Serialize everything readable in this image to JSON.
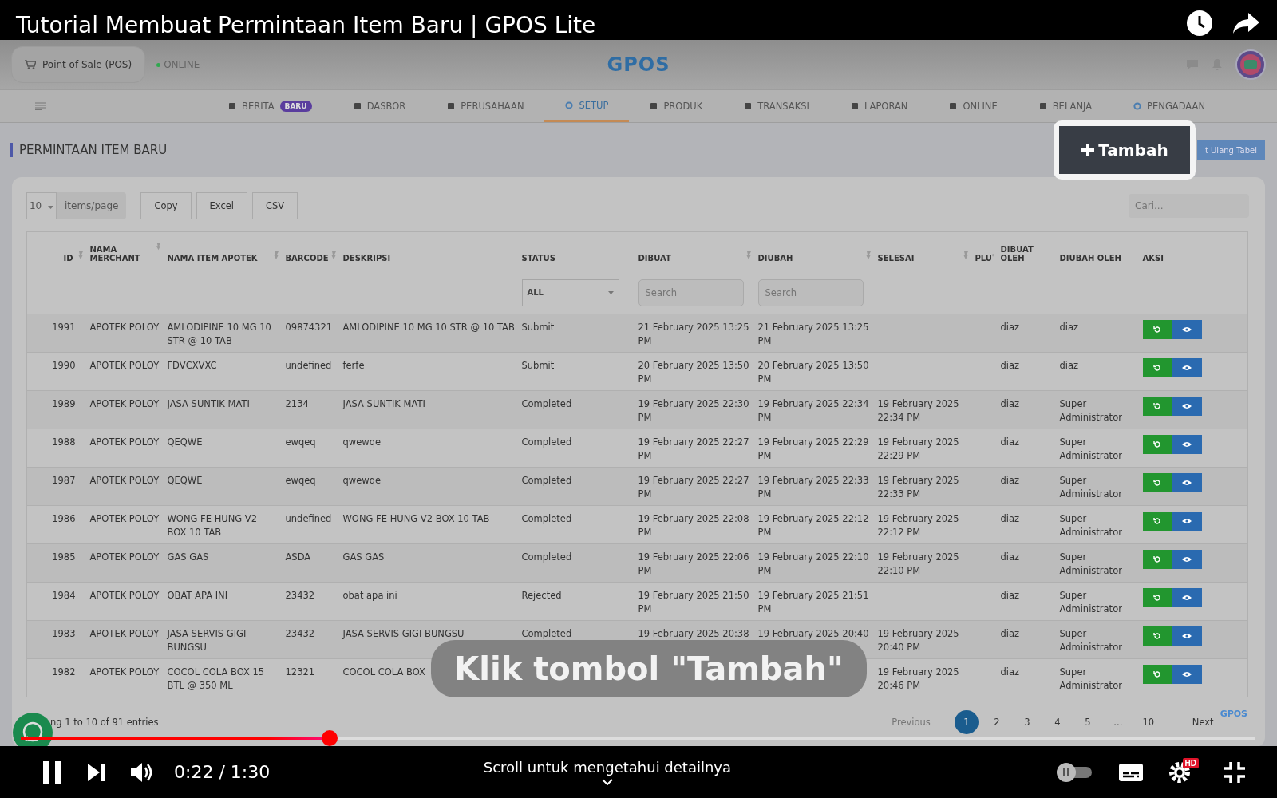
{
  "video_title": "Tutorial Membuat Permintaan Item Baru | GPOS Lite",
  "app": {
    "pos_button": "Point of Sale (POS)",
    "status": "ONLINE",
    "logo": "GPOS",
    "tabs": [
      {
        "label": "BERITA",
        "badge": "BARU",
        "selected": false
      },
      {
        "label": "DASBOR",
        "selected": false
      },
      {
        "label": "PERUSAHAAN",
        "selected": false
      },
      {
        "label": "SETUP",
        "selected": true
      },
      {
        "label": "PRODUK",
        "selected": false
      },
      {
        "label": "TRANSAKSI",
        "selected": false
      },
      {
        "label": "LAPORAN",
        "selected": false
      },
      {
        "label": "ONLINE",
        "selected": false
      },
      {
        "label": "BELANJA",
        "selected": false
      },
      {
        "label": "PENGADAAN",
        "selected": false
      }
    ],
    "page_title": "PERMINTAAN ITEM BARU",
    "add_button": "Tambah",
    "reload_button": "t Ulang Tabel",
    "page_size": "10",
    "page_size_label": "items/page",
    "export_buttons": [
      "Copy",
      "Excel",
      "CSV"
    ],
    "search": {
      "placeholder": "Cari..."
    },
    "table": {
      "columns": [
        {
          "label": "ID",
          "sortable": true
        },
        {
          "label": "NAMA MERCHANT",
          "sortable": true
        },
        {
          "label": "NAMA ITEM APOTEK",
          "sortable": true
        },
        {
          "label": "BARCODE",
          "sortable": true
        },
        {
          "label": "DESKRIPSI",
          "sortable": false
        },
        {
          "label": "STATUS",
          "sortable": false
        },
        {
          "label": "DIBUAT",
          "sortable": true
        },
        {
          "label": "DIUBAH",
          "sortable": true
        },
        {
          "label": "SELESAI",
          "sortable": true
        },
        {
          "label": "PLU",
          "sortable": true
        },
        {
          "label": "DIBUAT OLEH",
          "sortable": false
        },
        {
          "label": "DIUBAH OLEH",
          "sortable": false
        },
        {
          "label": "AKSI",
          "sortable": false
        }
      ],
      "filters": {
        "status": "ALL",
        "dibuat": {
          "placeholder": "Search"
        },
        "diubah": {
          "placeholder": "Search"
        }
      },
      "rows": [
        {
          "id": "1991",
          "merchant": "APOTEK POLOY",
          "item": "AMLODIPINE 10 MG 10 STR @ 10 TAB",
          "barcode": "09874321",
          "description": "AMLODIPINE 10 MG 10 STR @ 10 TAB",
          "status": "Submit",
          "created": "21 February 2025 13:25 PM",
          "changed": "21 February 2025 13:25 PM",
          "created_by": "diaz",
          "changed_by": "diaz"
        },
        {
          "id": "1990",
          "merchant": "APOTEK POLOY",
          "item": "FDVCXVXC",
          "barcode": "undefined",
          "description": "ferfe",
          "status": "Submit",
          "created": "20 February 2025 13:50 PM",
          "changed": "20 February 2025 13:50 PM",
          "created_by": "diaz",
          "changed_by": "diaz"
        },
        {
          "id": "1989",
          "merchant": "APOTEK POLOY",
          "item": "JASA SUNTIK MATI",
          "barcode": "2134",
          "description": "JASA SUNTIK MATI",
          "status": "Completed",
          "created": "19 February 2025 22:30 PM",
          "changed": "19 February 2025 22:34 PM",
          "finished": "19 February 2025 22:34 PM",
          "created_by": "diaz",
          "changed_by": "Super Administrator"
        },
        {
          "id": "1988",
          "merchant": "APOTEK POLOY",
          "item": "QEQWE",
          "barcode": "ewqeq",
          "description": "qwewqe",
          "status": "Completed",
          "created": "19 February 2025 22:27 PM",
          "changed": "19 February 2025 22:29 PM",
          "finished": "19 February 2025 22:29 PM",
          "created_by": "diaz",
          "changed_by": "Super Administrator"
        },
        {
          "id": "1987",
          "merchant": "APOTEK POLOY",
          "item": "QEQWE",
          "barcode": "ewqeq",
          "description": "qwewqe",
          "status": "Completed",
          "created": "19 February 2025 22:27 PM",
          "changed": "19 February 2025 22:33 PM",
          "finished": "19 February 2025 22:33 PM",
          "created_by": "diaz",
          "changed_by": "Super Administrator"
        },
        {
          "id": "1986",
          "merchant": "APOTEK POLOY",
          "item": "WONG FE HUNG V2 BOX 10 TAB",
          "barcode": "undefined",
          "description": "WONG FE HUNG V2 BOX 10 TAB",
          "status": "Completed",
          "created": "19 February 2025 22:08 PM",
          "changed": "19 February 2025 22:12 PM",
          "finished": "19 February 2025 22:12 PM",
          "created_by": "diaz",
          "changed_by": "Super Administrator"
        },
        {
          "id": "1985",
          "merchant": "APOTEK POLOY",
          "item": "GAS GAS",
          "barcode": "ASDA",
          "description": "GAS GAS",
          "status": "Completed",
          "created": "19 February 2025 22:06 PM",
          "changed": "19 February 2025 22:10 PM",
          "finished": "19 February 2025 22:10 PM",
          "created_by": "diaz",
          "changed_by": "Super Administrator"
        },
        {
          "id": "1984",
          "merchant": "APOTEK POLOY",
          "item": "OBAT APA INI",
          "barcode": "23432",
          "description": "obat apa ini",
          "status": "Rejected",
          "created": "19 February 2025 21:50 PM",
          "changed": "19 February 2025 21:51 PM",
          "created_by": "diaz",
          "changed_by": "Super Administrator"
        },
        {
          "id": "1983",
          "merchant": "APOTEK POLOY",
          "item": "JASA SERVIS GIGI BUNGSU",
          "barcode": "23432",
          "description": "JASA SERVIS GIGI BUNGSU",
          "status": "Completed",
          "created": "19 February 2025 20:38",
          "changed": "19 February 2025 20:40",
          "finished": "19 February 2025 20:40 PM",
          "created_by": "diaz",
          "changed_by": "Super Administrator"
        },
        {
          "id": "1982",
          "merchant": "APOTEK POLOY",
          "item": "COCOL COLA BOX 15 BTL @ 350 ML",
          "barcode": "12321",
          "description": "COCOL COLA BOX",
          "finished": "19 February 2025 20:46 PM",
          "created_by": "diaz",
          "changed_by": "Super Administrator"
        }
      ]
    },
    "entries_info": "ng 1 to 10 of 91 entries",
    "pagination": {
      "previous": "Previous",
      "pages": [
        {
          "label": "1",
          "selected": true
        },
        {
          "label": "2",
          "selected": false
        },
        {
          "label": "3",
          "selected": false
        },
        {
          "label": "4",
          "selected": false
        },
        {
          "label": "5",
          "selected": false
        },
        {
          "label": "...",
          "selected": false
        },
        {
          "label": "10",
          "selected": false
        }
      ],
      "next": "Next"
    },
    "footer_logo": "GPOS"
  },
  "caption": "Klik tombol \"Tambah\"",
  "player": {
    "progress": {
      "level": 0.25
    },
    "time": "0:22 / 1:30",
    "hint": "Scroll untuk mengetahui detailnya",
    "quality_badge": "HD"
  }
}
